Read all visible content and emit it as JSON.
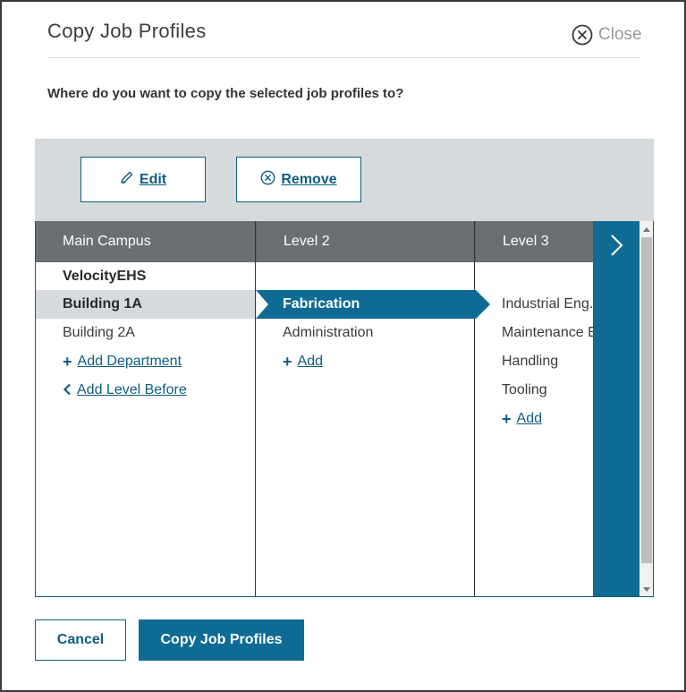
{
  "dialog": {
    "title": "Copy Job Profiles",
    "close_label": "Close",
    "question": "Where do you want to copy the selected job profiles to?"
  },
  "toolbar": {
    "edit_label": "Edit",
    "remove_label": "Remove"
  },
  "columns": [
    {
      "header": "Main Campus",
      "items": [
        "VelocityEHS",
        "Building 1A",
        "Building 2A"
      ],
      "links": [
        {
          "icon": "plus-icon",
          "label": "Add Department"
        },
        {
          "icon": "chevron-left-icon",
          "label": "Add Level Before"
        }
      ]
    },
    {
      "header": "Level 2",
      "items": [
        "Fabrication",
        "Administration"
      ],
      "links": [
        {
          "icon": "plus-icon",
          "label": "Add"
        }
      ]
    },
    {
      "header": "Level 3",
      "items": [
        "Industrial Eng.",
        "Maintenance E",
        "Handling",
        "Tooling"
      ],
      "links": [
        {
          "icon": "plus-icon",
          "label": "Add"
        }
      ]
    }
  ],
  "footer": {
    "cancel_label": "Cancel",
    "copy_label": "Copy Job Profiles"
  },
  "colors": {
    "accent": "#0f6b93",
    "header_grey": "#6b6f74",
    "toolbar_bg": "#d6dadd"
  }
}
